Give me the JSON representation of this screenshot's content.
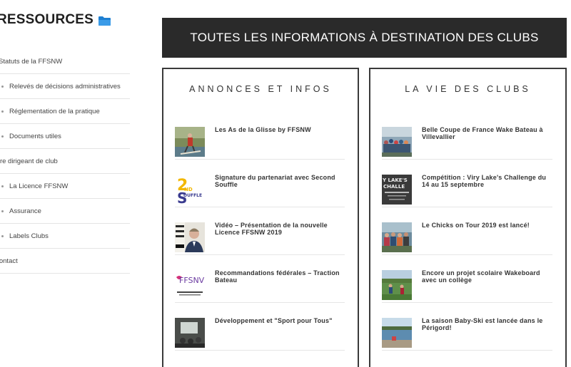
{
  "sidebar": {
    "title": "RESSOURCES",
    "items": [
      {
        "label": "Statuts de la FFSNW",
        "level": "top"
      },
      {
        "label": "Relevés de décisions administratives",
        "level": "sub"
      },
      {
        "label": "Réglementation de la pratique",
        "level": "sub"
      },
      {
        "label": "Documents utiles",
        "level": "sub"
      },
      {
        "label": "Être dirigeant de club",
        "level": "top"
      },
      {
        "label": "La Licence FFSNW",
        "level": "sub"
      },
      {
        "label": "Assurance",
        "level": "sub"
      },
      {
        "label": "Labels Clubs",
        "level": "sub"
      },
      {
        "label": "Contact",
        "level": "top"
      }
    ]
  },
  "banner": {
    "title": "TOUTES LES INFORMATIONS À DESTINATION DES CLUBS"
  },
  "columns": {
    "left": {
      "heading": "ANNONCES ET INFOS",
      "posts": [
        {
          "title": "Les As de la Glisse by FFSNW",
          "thumb": "water-ski-photo"
        },
        {
          "title": "Signature du partenariat avec Second Souffle",
          "thumb": "second-souffle-logo"
        },
        {
          "title": "Vidéo – Présentation de la nouvelle Licence FFSNW 2019",
          "thumb": "licence-video-photo"
        },
        {
          "title": "Recommandations fédérales – Traction Bateau",
          "thumb": "ffsnw-logo"
        },
        {
          "title": "Développement et \"Sport pour Tous\"",
          "thumb": "conference-photo"
        }
      ]
    },
    "right": {
      "heading": "LA VIE DES CLUBS",
      "posts": [
        {
          "title": "Belle Coupe de France Wake Bateau à Villevallier",
          "thumb": "group-photo"
        },
        {
          "title": "Compétition : Viry Lake's Challenge du 14 au 15 septembre",
          "thumb": "viry-lakes-poster"
        },
        {
          "title": "Le Chicks on Tour 2019 est lancé!",
          "thumb": "chicks-group-photo"
        },
        {
          "title": "Encore un projet scolaire Wakeboard avec un collège",
          "thumb": "school-field-photo"
        },
        {
          "title": "La saison Baby-Ski est lancée dans le Périgord!",
          "thumb": "lake-photo"
        }
      ]
    }
  }
}
